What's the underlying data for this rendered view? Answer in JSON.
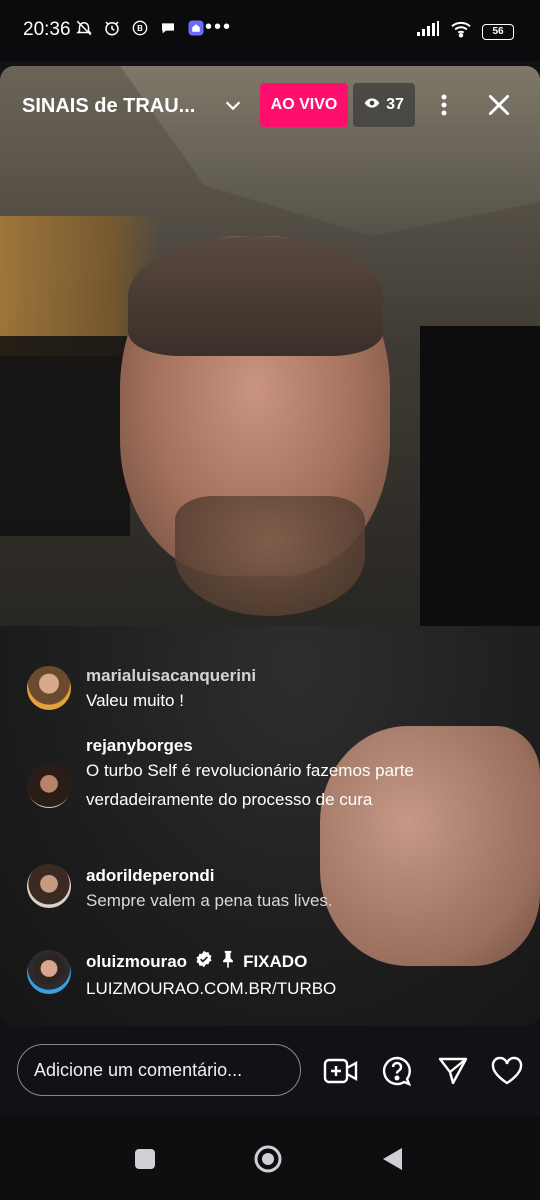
{
  "status_bar": {
    "time": "20:36",
    "battery": "56"
  },
  "live": {
    "title": "SINAIS de TRAU...",
    "badge": "AO VIVO",
    "viewers": "37"
  },
  "comments": [
    {
      "user": "marialuisacanquerini",
      "text": "Valeu muito !"
    },
    {
      "user": "rejanyborges",
      "text": "O turbo Self é revolucionário fazemos parte verdadeiramente do processo de cura"
    },
    {
      "user": "adorildeperondi",
      "text": "Sempre valem a pena tuas lives."
    }
  ],
  "pinned": {
    "user": "oluizmourao",
    "label": "FIXADO",
    "text": "LUIZMOURAO.COM.BR/TURBO"
  },
  "input": {
    "placeholder": "Adicione um comentário..."
  },
  "icons": {
    "add_video": "add-video-icon",
    "question": "question-icon",
    "share": "send-icon",
    "like": "heart-icon"
  },
  "colors": {
    "live_badge": "#ff0f6d",
    "background": "#111216"
  }
}
